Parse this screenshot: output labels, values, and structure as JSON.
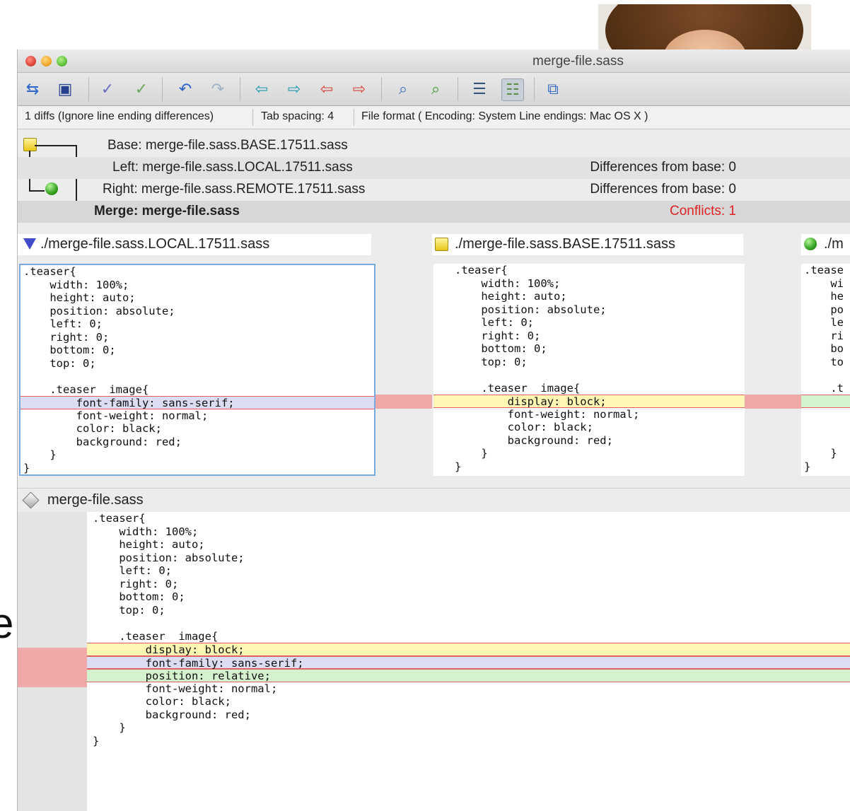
{
  "window": {
    "title": "merge-file.sass"
  },
  "toolbar": {
    "icons": [
      "sync-icon",
      "save-icon",
      "check-icon",
      "check-all-icon",
      "undo-icon",
      "redo-icon",
      "prev-diff-icon",
      "next-diff-icon",
      "prev-conflict-icon",
      "next-conflict-icon",
      "find-icon",
      "find-next-icon",
      "list-icon",
      "merge-view-icon",
      "copy-icon"
    ]
  },
  "status": {
    "diffs": "1 diffs (Ignore line ending differences)",
    "tab_spacing": "Tab spacing: 4",
    "file_format": "File format ( Encoding: System  Line endings: Mac OS X )"
  },
  "files": {
    "base": "Base: merge-file.sass.BASE.17511.sass",
    "left": "Left: merge-file.sass.LOCAL.17511.sass",
    "left_diff": "Differences from base: 0",
    "right": "Right: merge-file.sass.REMOTE.17511.sass",
    "right_diff": "Differences from base: 0",
    "merge": "Merge: merge-file.sass",
    "conflicts": "Conflicts: 1"
  },
  "panes": {
    "left_title": "./merge-file.sass.LOCAL.17511.sass",
    "base_title": "./merge-file.sass.BASE.17511.sass",
    "right_title": "./m",
    "left_lines": [
      ".teaser{",
      "    width: 100%;",
      "    height: auto;",
      "    position: absolute;",
      "    left: 0;",
      "    right: 0;",
      "    bottom: 0;",
      "    top: 0;",
      "",
      "    .teaser  image{",
      "        font-family: sans-serif;",
      "        font-weight: normal;",
      "        color: black;",
      "        background: red;",
      "    }",
      "}"
    ],
    "base_lines": [
      ".teaser{",
      "    width: 100%;",
      "    height: auto;",
      "    position: absolute;",
      "    left: 0;",
      "    right: 0;",
      "    bottom: 0;",
      "    top: 0;",
      "",
      "    .teaser  image{",
      "        display: block;",
      "        font-weight: normal;",
      "        color: black;",
      "        background: red;",
      "    }",
      "}"
    ],
    "right_lines": [
      ".tease",
      "    wi",
      "    he",
      "    po",
      "    le",
      "    ri",
      "    bo",
      "    to",
      "",
      "    .t",
      "",
      "",
      "",
      "",
      "    }",
      "}"
    ]
  },
  "merge": {
    "title": "merge-file.sass",
    "lines": [
      ".teaser{",
      "    width: 100%;",
      "    height: auto;",
      "    position: absolute;",
      "    left: 0;",
      "    right: 0;",
      "    bottom: 0;",
      "    top: 0;",
      "",
      "    .teaser  image{",
      "        display: block;",
      "        font-family: sans-serif;",
      "        position: relative;",
      "        font-weight: normal;",
      "        color: black;",
      "        background: red;",
      "    }",
      "}"
    ]
  },
  "colors": {
    "conflict": "#e02222",
    "local_highlight": "#dcdcf2",
    "base_highlight": "#fdf7b3",
    "remote_highlight": "#d5f2cf"
  }
}
